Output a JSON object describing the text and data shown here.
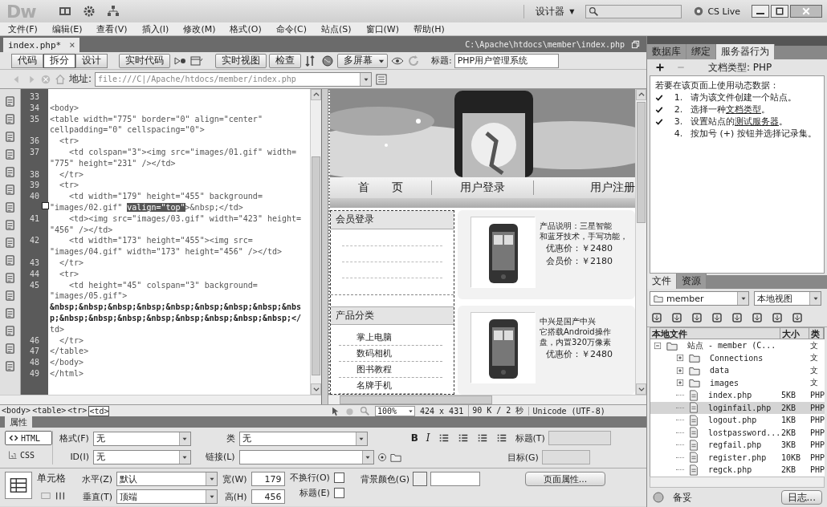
{
  "app": {
    "logo": "Dw",
    "workspace": "设计器",
    "caret": "▼",
    "cs_live": "CS Live"
  },
  "menu": [
    "文件(F)",
    "编辑(E)",
    "查看(V)",
    "插入(I)",
    "修改(M)",
    "格式(O)",
    "命令(C)",
    "站点(S)",
    "窗口(W)",
    "帮助(H)"
  ],
  "document": {
    "tab": "index.php*",
    "close": "×",
    "path": "C:\\Apache\\htdocs\\member\\index.php"
  },
  "toolbar": {
    "views": [
      {
        "label": "代码",
        "selected": false
      },
      {
        "label": "拆分",
        "selected": true
      },
      {
        "label": "设计",
        "selected": false
      }
    ],
    "live_code": "实时代码",
    "live_view": "实时视图",
    "inspect": "检查",
    "multiscreen": "多屏幕",
    "title_label": "标题:",
    "title_value": "PHP用户管理系统"
  },
  "address": {
    "label": "地址:",
    "value": "file:///C|/Apache/htdocs/member/index.php"
  },
  "code": {
    "lines": [
      {
        "number": "33"
      },
      {
        "number": "34",
        "text": "<body>"
      },
      {
        "number": "35",
        "text": "<table width=\"775\" border=\"0\" align=\"center\""
      },
      {
        "text": "cellpadding=\"0\" cellspacing=\"0\">"
      },
      {
        "number": "36",
        "text": "  <tr>"
      },
      {
        "number": "37",
        "text": "    <td colspan=\"3\"><img src=\"images/01.gif\" width="
      },
      {
        "text": "\"775\" height=\"231\" /></td>"
      },
      {
        "number": "38",
        "text": "  </tr>"
      },
      {
        "number": "39",
        "text": "  <tr>"
      },
      {
        "number": "40",
        "text": "    <td width=\"179\" height=\"455\" background="
      },
      {
        "fold": true,
        "parts": [
          {
            "text": "\"images/02.gif\" ",
            "selected": false
          },
          {
            "text": "valign=\"top\"",
            "selected": true
          },
          {
            "text": ">&nbsp;</td>",
            "selected": false
          }
        ]
      },
      {
        "number": "41",
        "text": "    <td><img src=\"images/03.gif\" width=\"423\" height="
      },
      {
        "text": "\"456\" /></td>"
      },
      {
        "number": "42",
        "text": "    <td width=\"173\" height=\"455\"><img src="
      },
      {
        "text": "\"images/04.gif\" width=\"173\" height=\"456\" /></td>"
      },
      {
        "number": "43",
        "text": "  </tr>"
      },
      {
        "number": "44",
        "text": "  <tr>"
      },
      {
        "number": "45",
        "text": "    <td height=\"45\" colspan=\"3\" background="
      },
      {
        "text": "\"images/05.gif\">"
      },
      {
        "kind": "entity",
        "text": "&nbsp;&nbsp;&nbsp;&nbsp;&nbsp;&nbsp;&nbsp;&nbsp;&nbs"
      },
      {
        "kind": "entity",
        "text": "p;&nbsp;&nbsp;&nbsp;&nbsp;&nbsp;&nbsp;&nbsp;&nbsp;</"
      },
      {
        "text": "td>"
      },
      {
        "number": "46",
        "text": "  </tr>"
      },
      {
        "number": "47",
        "text": "</table>"
      },
      {
        "number": "48",
        "text": "</body>"
      },
      {
        "number": "49",
        "text": "</html>"
      }
    ]
  },
  "design": {
    "nav": [
      "首　　页",
      "用户登录",
      "用户注册"
    ],
    "login_title": "会员登录",
    "category_title": "产品分类",
    "categories": [
      "掌上电脑",
      "数码相机",
      "图书教程",
      "名牌手机"
    ],
    "products": [
      {
        "description": [
          "产品说明：三星智能",
          "和蓝牙技术，手写功能，"
        ],
        "prices": [
          "优惠价：￥2480",
          "会员价：￥2180"
        ]
      },
      {
        "description": [
          "中兴是国产中兴",
          "它搭载Android操作",
          "盘，内置320万像素"
        ],
        "prices": [
          "优惠价：￥2480"
        ]
      }
    ]
  },
  "tag_selector": [
    {
      "label": "<body>",
      "selected": false
    },
    {
      "label": "<table>",
      "selected": false
    },
    {
      "label": "<tr>",
      "selected": false
    },
    {
      "label": "<td>",
      "selected": true
    }
  ],
  "design_status": {
    "zoom": "100%",
    "size": "424 x 431",
    "download": "90 K / 2 秒",
    "encoding": "Unicode (UTF-8)"
  },
  "properties": {
    "title": "属性",
    "modes": [
      {
        "label": "HTML",
        "selected": true
      },
      {
        "label": "CSS",
        "selected": false
      }
    ],
    "format": {
      "label": "格式(F)",
      "value": "无"
    },
    "id": {
      "label": "ID(I)",
      "value": "无"
    },
    "class": {
      "label": "类",
      "value": "无"
    },
    "bold": "B",
    "italic": "I",
    "heading": {
      "label": "标题(T)",
      "disabled": true
    },
    "link": {
      "label": "链接(L)"
    },
    "target": {
      "label": "目标(G)",
      "disabled": true
    },
    "cell_label": "单元格",
    "horz": {
      "label": "水平(Z)",
      "value": "默认"
    },
    "vert": {
      "label": "垂直(T)",
      "value": "顶端"
    },
    "width": {
      "label": "宽(W)",
      "value": "179"
    },
    "height": {
      "label": "高(H)",
      "value": "456"
    },
    "nowrap": {
      "label": "不换行(O)",
      "checked": false
    },
    "header": {
      "label": "标题(E)",
      "checked": false
    },
    "bg": {
      "label": "背景颜色(G)"
    },
    "page_button": "页面属性..."
  },
  "server_panel": {
    "tabs": [
      {
        "label": "数据库",
        "selected": false
      },
      {
        "label": "绑定",
        "selected": false
      },
      {
        "label": "服务器行为",
        "selected": true
      }
    ],
    "doc_type": "文档类型: PHP",
    "intro": "若要在该页面上使用动态数据：",
    "steps": [
      {
        "checked": true,
        "number": "1.",
        "parts": [
          {
            "text": "请为该文件创建一个站点。",
            "link": false
          }
        ]
      },
      {
        "checked": true,
        "number": "2.",
        "parts": [
          {
            "text": "选择一种",
            "link": false
          },
          {
            "text": "文档类型",
            "link": true
          },
          {
            "text": "。",
            "link": false
          }
        ]
      },
      {
        "checked": true,
        "number": "3.",
        "parts": [
          {
            "text": "设置站点的",
            "link": false
          },
          {
            "text": "测试服务器",
            "link": true
          },
          {
            "text": "。",
            "link": false
          }
        ]
      },
      {
        "checked": false,
        "number": "4.",
        "parts": [
          {
            "text": "按加号 (+) 按钮并选择记录集。",
            "link": false
          }
        ]
      }
    ]
  },
  "files_panel": {
    "tabs": [
      {
        "label": "文件",
        "selected": true
      },
      {
        "label": "资源",
        "selected": false
      }
    ],
    "site": "member",
    "view": "本地视图",
    "columns": [
      "本地文件",
      "大小",
      "类"
    ],
    "tree": [
      {
        "kind": "site",
        "name": "站点 - member (C...",
        "type": "文",
        "expanded": true,
        "selected": false,
        "children": [
          {
            "kind": "folder",
            "name": "Connections",
            "type": "文",
            "expanded": false,
            "selected": false
          },
          {
            "kind": "folder",
            "name": "data",
            "type": "文",
            "expanded": false,
            "selected": false
          },
          {
            "kind": "folder",
            "name": "images",
            "type": "文",
            "expanded": false,
            "selected": false
          },
          {
            "kind": "file",
            "name": "index.php",
            "size": "5KB",
            "type": "PHP",
            "selected": false
          },
          {
            "kind": "file",
            "name": "loginfail.php",
            "size": "2KB",
            "type": "PHP",
            "selected": true
          },
          {
            "kind": "file",
            "name": "logout.php",
            "size": "1KB",
            "type": "PHP",
            "selected": false
          },
          {
            "kind": "file",
            "name": "lostpassword...",
            "size": "2KB",
            "type": "PHP",
            "selected": false
          },
          {
            "kind": "file",
            "name": "regfail.php",
            "size": "3KB",
            "type": "PHP",
            "selected": false
          },
          {
            "kind": "file",
            "name": "register.php",
            "size": "10KB",
            "type": "PHP",
            "selected": false
          },
          {
            "kind": "file",
            "name": "regck.php",
            "size": "2KB",
            "type": "PHP",
            "selected": false
          }
        ]
      }
    ],
    "status": "备妥",
    "log_button": "日志..."
  }
}
